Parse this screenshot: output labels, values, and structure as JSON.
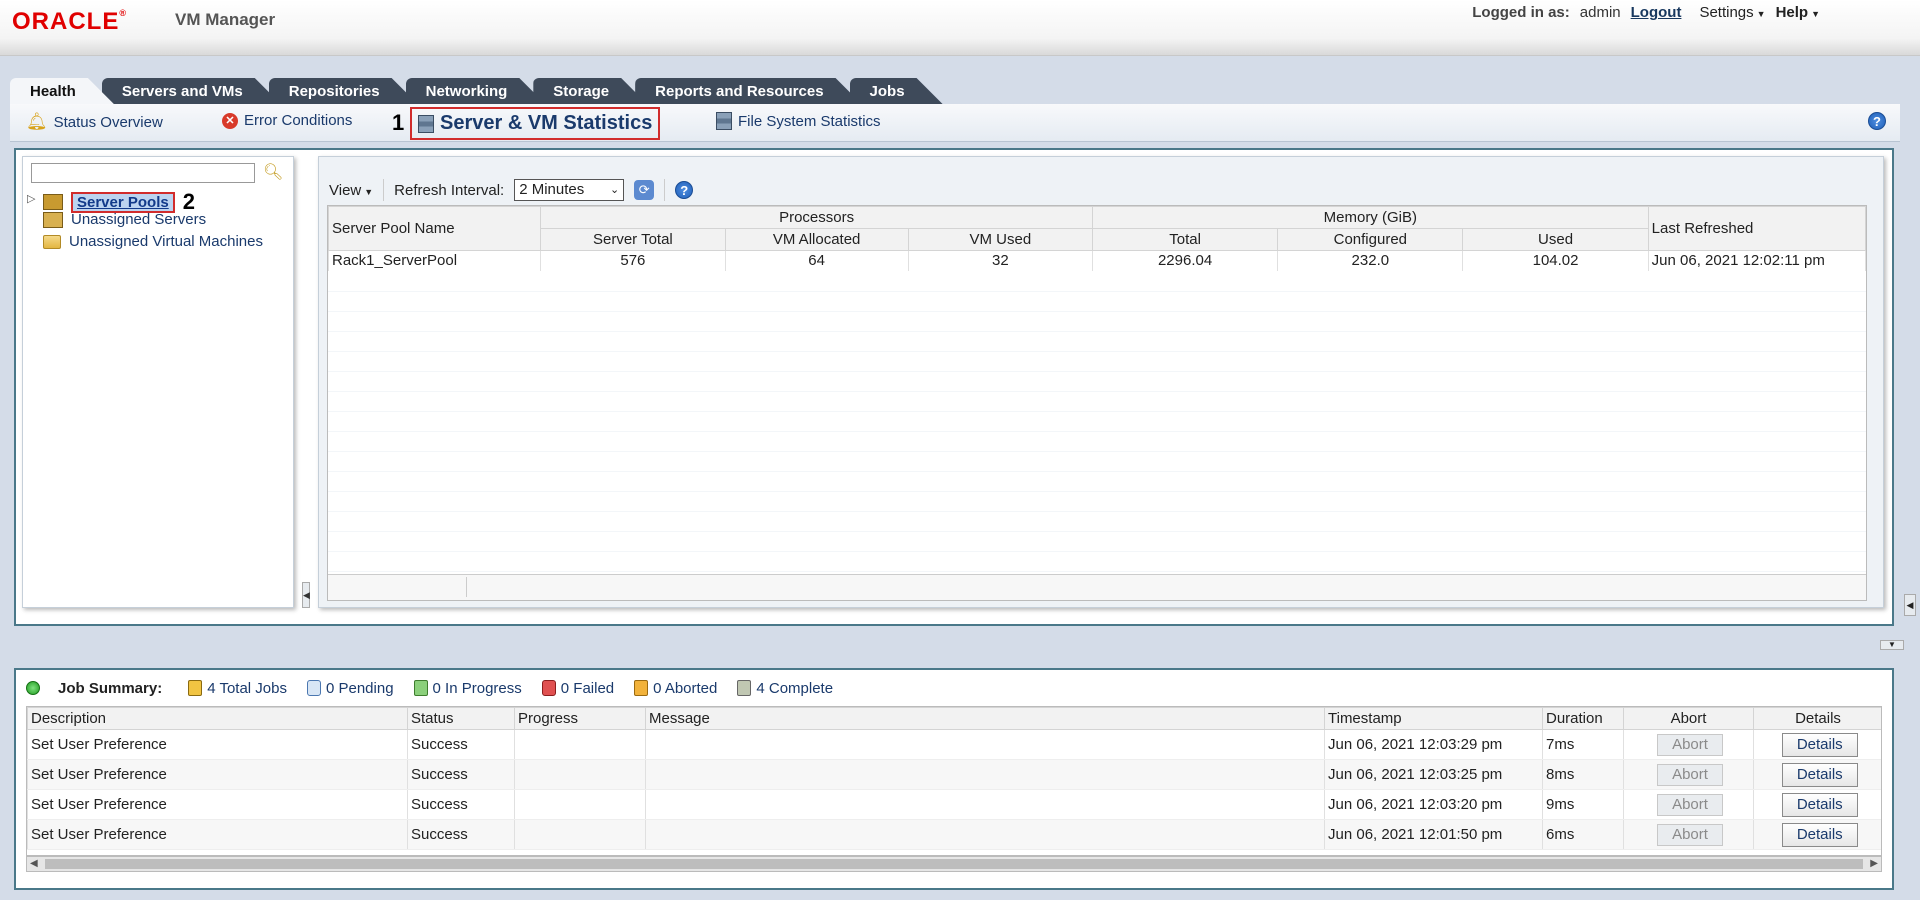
{
  "header": {
    "brand": "ORACLE",
    "product": "VM Manager",
    "logged_in_label": "Logged in as:",
    "username": "admin",
    "logout": "Logout",
    "settings": "Settings",
    "help": "Help"
  },
  "tabs": [
    {
      "label": "Health",
      "active": true
    },
    {
      "label": "Servers and VMs",
      "active": false
    },
    {
      "label": "Repositories",
      "active": false
    },
    {
      "label": "Networking",
      "active": false
    },
    {
      "label": "Storage",
      "active": false
    },
    {
      "label": "Reports and Resources",
      "active": false
    },
    {
      "label": "Jobs",
      "active": false
    }
  ],
  "subtabs": {
    "status_overview": "Status Overview",
    "error_conditions": "Error Conditions",
    "server_vm_stats": "Server & VM Statistics",
    "fs_stats": "File System Statistics"
  },
  "annotations": {
    "one": "1",
    "two": "2"
  },
  "tree": {
    "search_value": "",
    "items": [
      {
        "label": "Server Pools"
      },
      {
        "label": "Unassigned Servers"
      },
      {
        "label": "Unassigned Virtual Machines"
      }
    ]
  },
  "toolbar": {
    "view": "View",
    "refresh_label": "Refresh Interval:",
    "refresh_value": "2 Minutes"
  },
  "stats_table": {
    "group_processors": "Processors",
    "group_memory": "Memory (GiB)",
    "columns": [
      "Server Pool Name",
      "Server Total",
      "VM Allocated",
      "VM Used",
      "Total",
      "Configured",
      "Used",
      "Last Refreshed"
    ],
    "rows": [
      [
        "Rack1_ServerPool",
        "576",
        "64",
        "32",
        "2296.04",
        "232.0",
        "104.02",
        "Jun 06, 2021 12:02:11 pm"
      ]
    ]
  },
  "job_summary": {
    "title": "Job Summary:",
    "total": "4 Total Jobs",
    "pending": "0 Pending",
    "in_progress": "0 In Progress",
    "failed": "0 Failed",
    "aborted": "0 Aborted",
    "complete": "4 Complete",
    "columns": [
      "Description",
      "Status",
      "Progress",
      "Message",
      "Timestamp",
      "Duration",
      "Abort",
      "Details"
    ],
    "rows": [
      {
        "description": "Set User Preference",
        "status": "Success",
        "progress": "",
        "message": "",
        "timestamp": "Jun 06, 2021 12:03:29 pm",
        "duration": "7ms",
        "abort": "Abort",
        "details": "Details"
      },
      {
        "description": "Set User Preference",
        "status": "Success",
        "progress": "",
        "message": "",
        "timestamp": "Jun 06, 2021 12:03:25 pm",
        "duration": "8ms",
        "abort": "Abort",
        "details": "Details"
      },
      {
        "description": "Set User Preference",
        "status": "Success",
        "progress": "",
        "message": "",
        "timestamp": "Jun 06, 2021 12:03:20 pm",
        "duration": "9ms",
        "abort": "Abort",
        "details": "Details"
      },
      {
        "description": "Set User Preference",
        "status": "Success",
        "progress": "",
        "message": "",
        "timestamp": "Jun 06, 2021 12:01:50 pm",
        "duration": "6ms",
        "abort": "Abort",
        "details": "Details"
      }
    ]
  },
  "colors": {
    "brand_red": "#e00000",
    "link_blue": "#1a3a6c",
    "highlight_red": "#d12c2c",
    "tab_dark": "#3e4a5a"
  }
}
